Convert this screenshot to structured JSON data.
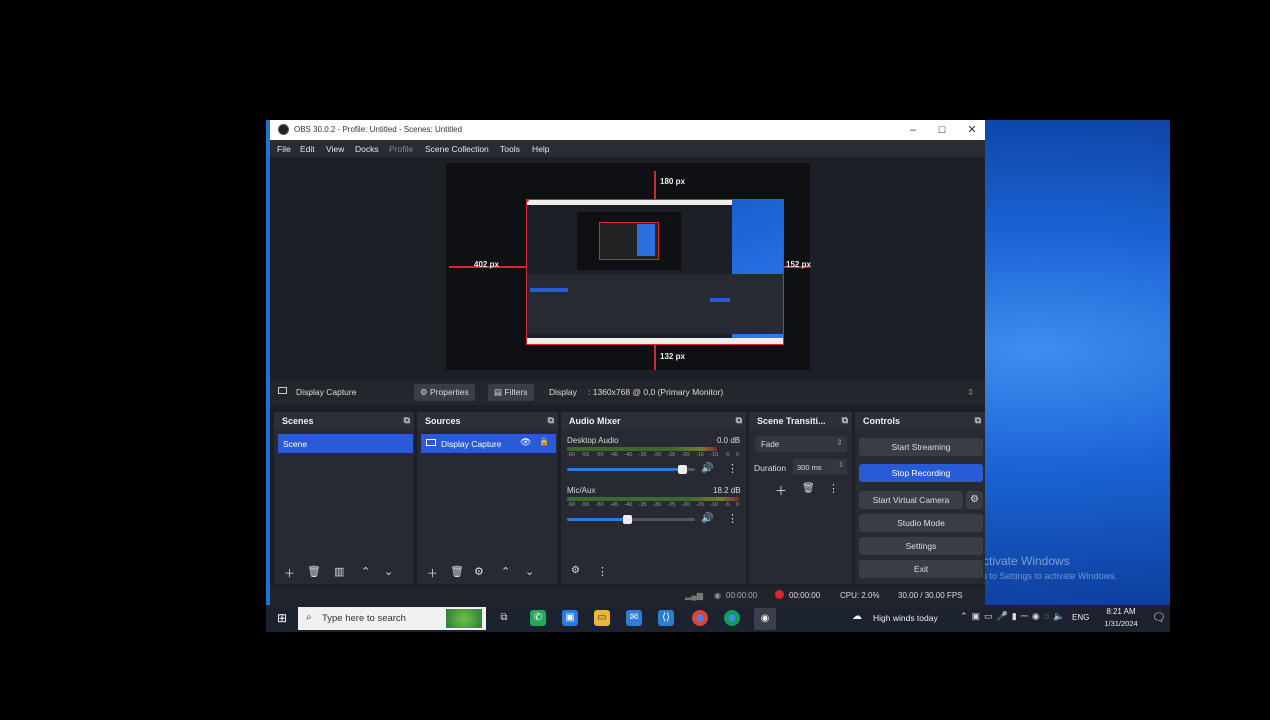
{
  "window": {
    "title": "OBS 30.0.2 - Profile: Untitled - Scenes: Untitled",
    "minimize": "–",
    "maximize": "☐",
    "close": "✕"
  },
  "menu": [
    "File",
    "Edit",
    "View",
    "Docks",
    "Profile",
    "Scene Collection",
    "Tools",
    "Help"
  ],
  "preview": {
    "top_label": "180 px",
    "left_label": "402 px",
    "right_label": "152 px",
    "bottom_label": "132 px"
  },
  "source_bar": {
    "source_name": "Display Capture",
    "properties": "Properties",
    "filters": "Filters",
    "display_label": "Display",
    "display_value": ": 1360x768 @ 0,0 (Primary Monitor)"
  },
  "scenes": {
    "title": "Scenes",
    "items": [
      "Scene"
    ]
  },
  "sources": {
    "title": "Sources",
    "items": [
      "Display Capture"
    ]
  },
  "audio_mixer": {
    "title": "Audio Mixer",
    "channels": [
      {
        "name": "Desktop Audio",
        "db": "0.0 dB",
        "volume": 0.9
      },
      {
        "name": "Mic/Aux",
        "db": "18.2 dB",
        "volume": 0.47
      }
    ],
    "scale": [
      "-60",
      "-55",
      "-50",
      "-45",
      "-40",
      "-35",
      "-30",
      "-25",
      "-20",
      "-15",
      "-10",
      "-5",
      "0"
    ]
  },
  "transitions": {
    "title": "Scene Transiti...",
    "selected": "Fade",
    "duration_label": "Duration",
    "duration_value": "300 ms"
  },
  "controls": {
    "title": "Controls",
    "start_streaming": "Start Streaming",
    "stop_recording": "Stop Recording",
    "start_virtual_camera": "Start Virtual Camera",
    "studio_mode": "Studio Mode",
    "settings": "Settings",
    "exit": "Exit"
  },
  "status": {
    "stream_time": "00:00:00",
    "rec_time": "00:00:00",
    "cpu": "CPU: 2.0%",
    "fps": "30.00 / 30.00 FPS"
  },
  "desktop": {
    "watermark_title": "Activate Windows",
    "watermark_sub": "Go to Settings to activate Windows."
  },
  "taskbar": {
    "search_placeholder": "Type here to search",
    "weather": "High winds today",
    "language": "ENG",
    "time": "8:21 AM",
    "date": "1/31/2024"
  },
  "colors": {
    "accent": "#2a5bd7",
    "record": "#e0222a",
    "obs_bg": "#1d1f26"
  }
}
